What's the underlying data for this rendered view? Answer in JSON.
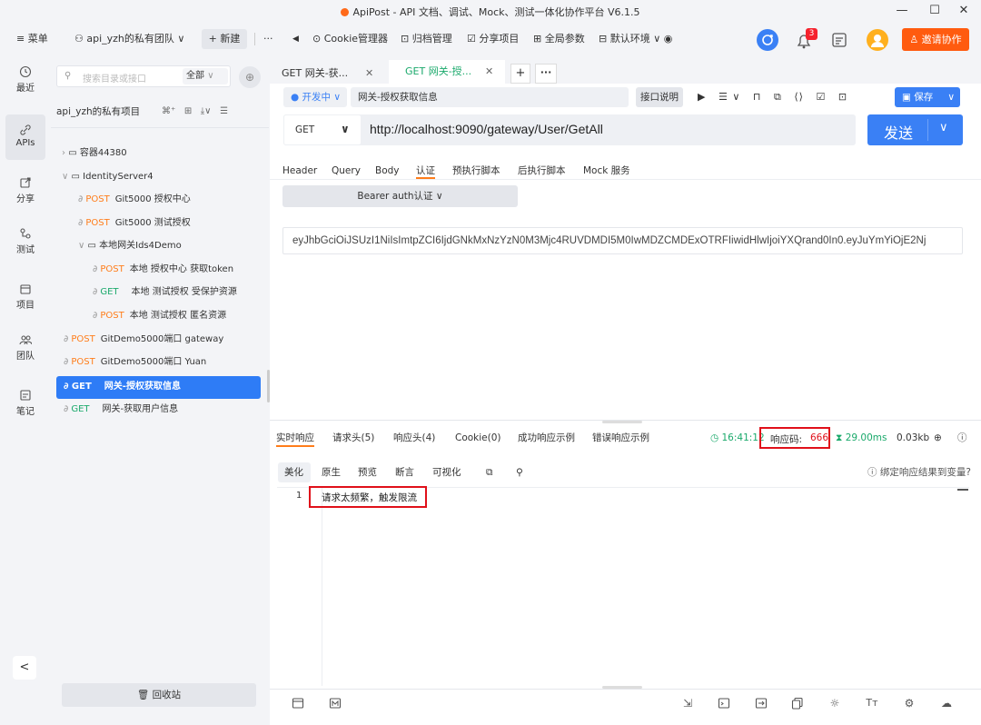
{
  "window": {
    "title": "ApiPost - API 文档、调试、Mock、测试一体化协作平台 V6.1.5",
    "minimize": "—",
    "maximize": "☐",
    "close": "✕"
  },
  "toolbar": {
    "menu": "菜单",
    "team": "api_yzh的私有团队",
    "new": "+ 新建",
    "more": "···",
    "back": "◀",
    "cookie": "Cookie管理器",
    "archive": "归档管理",
    "share": "分享项目",
    "globals": "全局参数",
    "env": "默认环境",
    "badge": "3",
    "invite": "邀请协作"
  },
  "rail": [
    {
      "label": "最近",
      "icon": "clock-icon"
    },
    {
      "label": "APIs",
      "icon": "link-icon"
    },
    {
      "label": "分享",
      "icon": "share-icon"
    },
    {
      "label": "测试",
      "icon": "test-icon"
    },
    {
      "label": "项目",
      "icon": "folder-icon"
    },
    {
      "label": "团队",
      "icon": "team-icon"
    },
    {
      "label": "笔记",
      "icon": "note-icon"
    }
  ],
  "sidebar": {
    "search_placeholder": "搜索目录或接口",
    "filter": "全部",
    "project": "api_yzh的私有项目",
    "items": [
      {
        "method": "",
        "label": "容器44380"
      },
      {
        "method": "",
        "label": "IdentityServer4"
      },
      {
        "method": "POST",
        "label": "Git5000 授权中心"
      },
      {
        "method": "POST",
        "label": "Git5000 测试授权"
      },
      {
        "method": "",
        "label": "本地网关Ids4Demo"
      },
      {
        "method": "POST",
        "label": "本地 授权中心 获取token"
      },
      {
        "method": "GET",
        "label": "本地 测试授权 受保护资源"
      },
      {
        "method": "POST",
        "label": "本地 测试授权 匿名资源"
      },
      {
        "method": "POST",
        "label": "GitDemo5000端口 gateway"
      },
      {
        "method": "POST",
        "label": "GitDemo5000端口 Yuan"
      },
      {
        "method": "GET",
        "label": "网关-授权获取信息"
      },
      {
        "method": "GET",
        "label": "网关-获取用户信息"
      }
    ],
    "recycle": "回收站"
  },
  "tabs": [
    {
      "label": "GET 网关-获..."
    },
    {
      "label": "GET 网关-授..."
    }
  ],
  "request": {
    "env": "● 开发中",
    "name": "网关-授权获取信息",
    "doc": "接口说明",
    "save": "保存",
    "method": "GET",
    "url": "http://localhost:9090/gateway/User/GetAll",
    "send": "发送",
    "subtabs": [
      "Header",
      "Query",
      "Body",
      "认证",
      "预执行脚本",
      "后执行脚本",
      "Mock 服务"
    ],
    "auth_type": "Bearer auth认证",
    "token": "eyJhbGciOiJSUzI1NiIsImtpZCI6IjdGNkMxNzYzN0M3Mjc4RUVDMDI5M0IwMDZCMDExOTRFIiwidHlwIjoiYXQrand0In0.eyJuYmYiOjE2Nj"
  },
  "response": {
    "tabs": [
      "实时响应",
      "请求头(5)",
      "响应头(4)",
      "Cookie(0)",
      "成功响应示例",
      "错误响应示例"
    ],
    "time": "16:41:12",
    "code_label": "响应码:",
    "code": "666",
    "duration": "29.00ms",
    "size": "0.03kb",
    "format_tabs": [
      "美化",
      "原生",
      "预览",
      "断言",
      "可视化"
    ],
    "bind": "绑定响应结果到变量?",
    "line_no": "1",
    "body": "请求太频繁，触发限流"
  }
}
